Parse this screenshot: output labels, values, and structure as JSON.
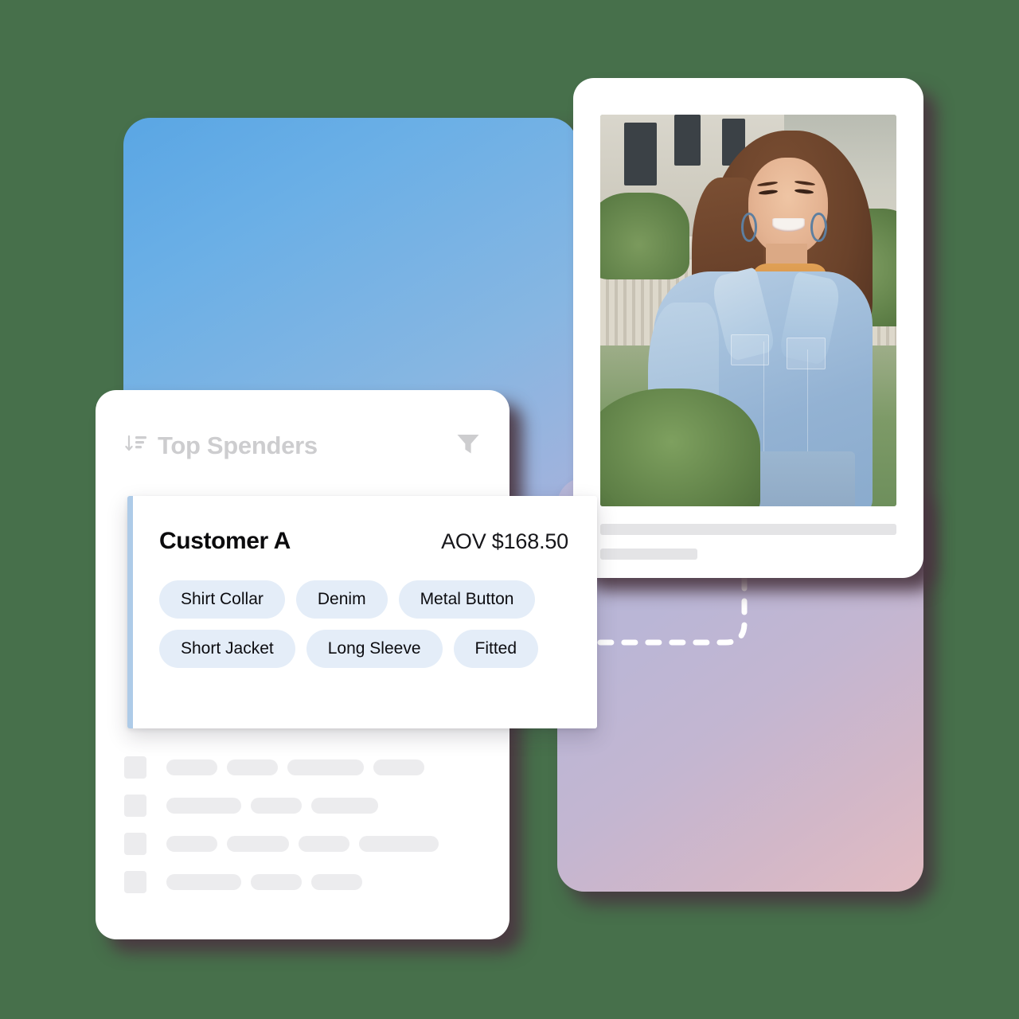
{
  "panels": {
    "blue_panel": {
      "name": "blue-gradient-panel",
      "accent": "#6aafe6"
    },
    "purple_panel": {
      "name": "purple-gradient-panel",
      "accent": "#c3b6d1"
    },
    "card_shadow_color": "#4a3540"
  },
  "list_card": {
    "title": "Top Spenders",
    "sort_icon": "sort-descending-icon",
    "filter_icon": "filter-funnel-icon",
    "title_color": "#cdcdcf",
    "skeleton_rows": [
      {
        "bars": [
          64,
          64,
          96,
          64
        ]
      },
      {
        "bars": [
          94,
          64,
          84
        ]
      },
      {
        "bars": [
          64,
          78,
          64,
          100
        ]
      },
      {
        "bars": [
          94,
          64,
          64
        ]
      }
    ]
  },
  "customer_card": {
    "accent_color": "#aecbe8",
    "name": "Customer A",
    "aov_label": "AOV $168.50",
    "tag_background": "#e4edf8",
    "tag_rows": [
      [
        "Shirt Collar",
        "Denim",
        "Metal Button"
      ],
      [
        "Short Jacket",
        "Long Sleeve",
        "Fitted"
      ]
    ]
  },
  "photo_card": {
    "photo_alt": "smiling-woman-in-denim-jacket",
    "skeleton_lines": [
      {
        "width": "long"
      },
      {
        "width": "short"
      }
    ]
  },
  "connector": {
    "name": "dashed-connector-line",
    "color": "#ffffff"
  }
}
